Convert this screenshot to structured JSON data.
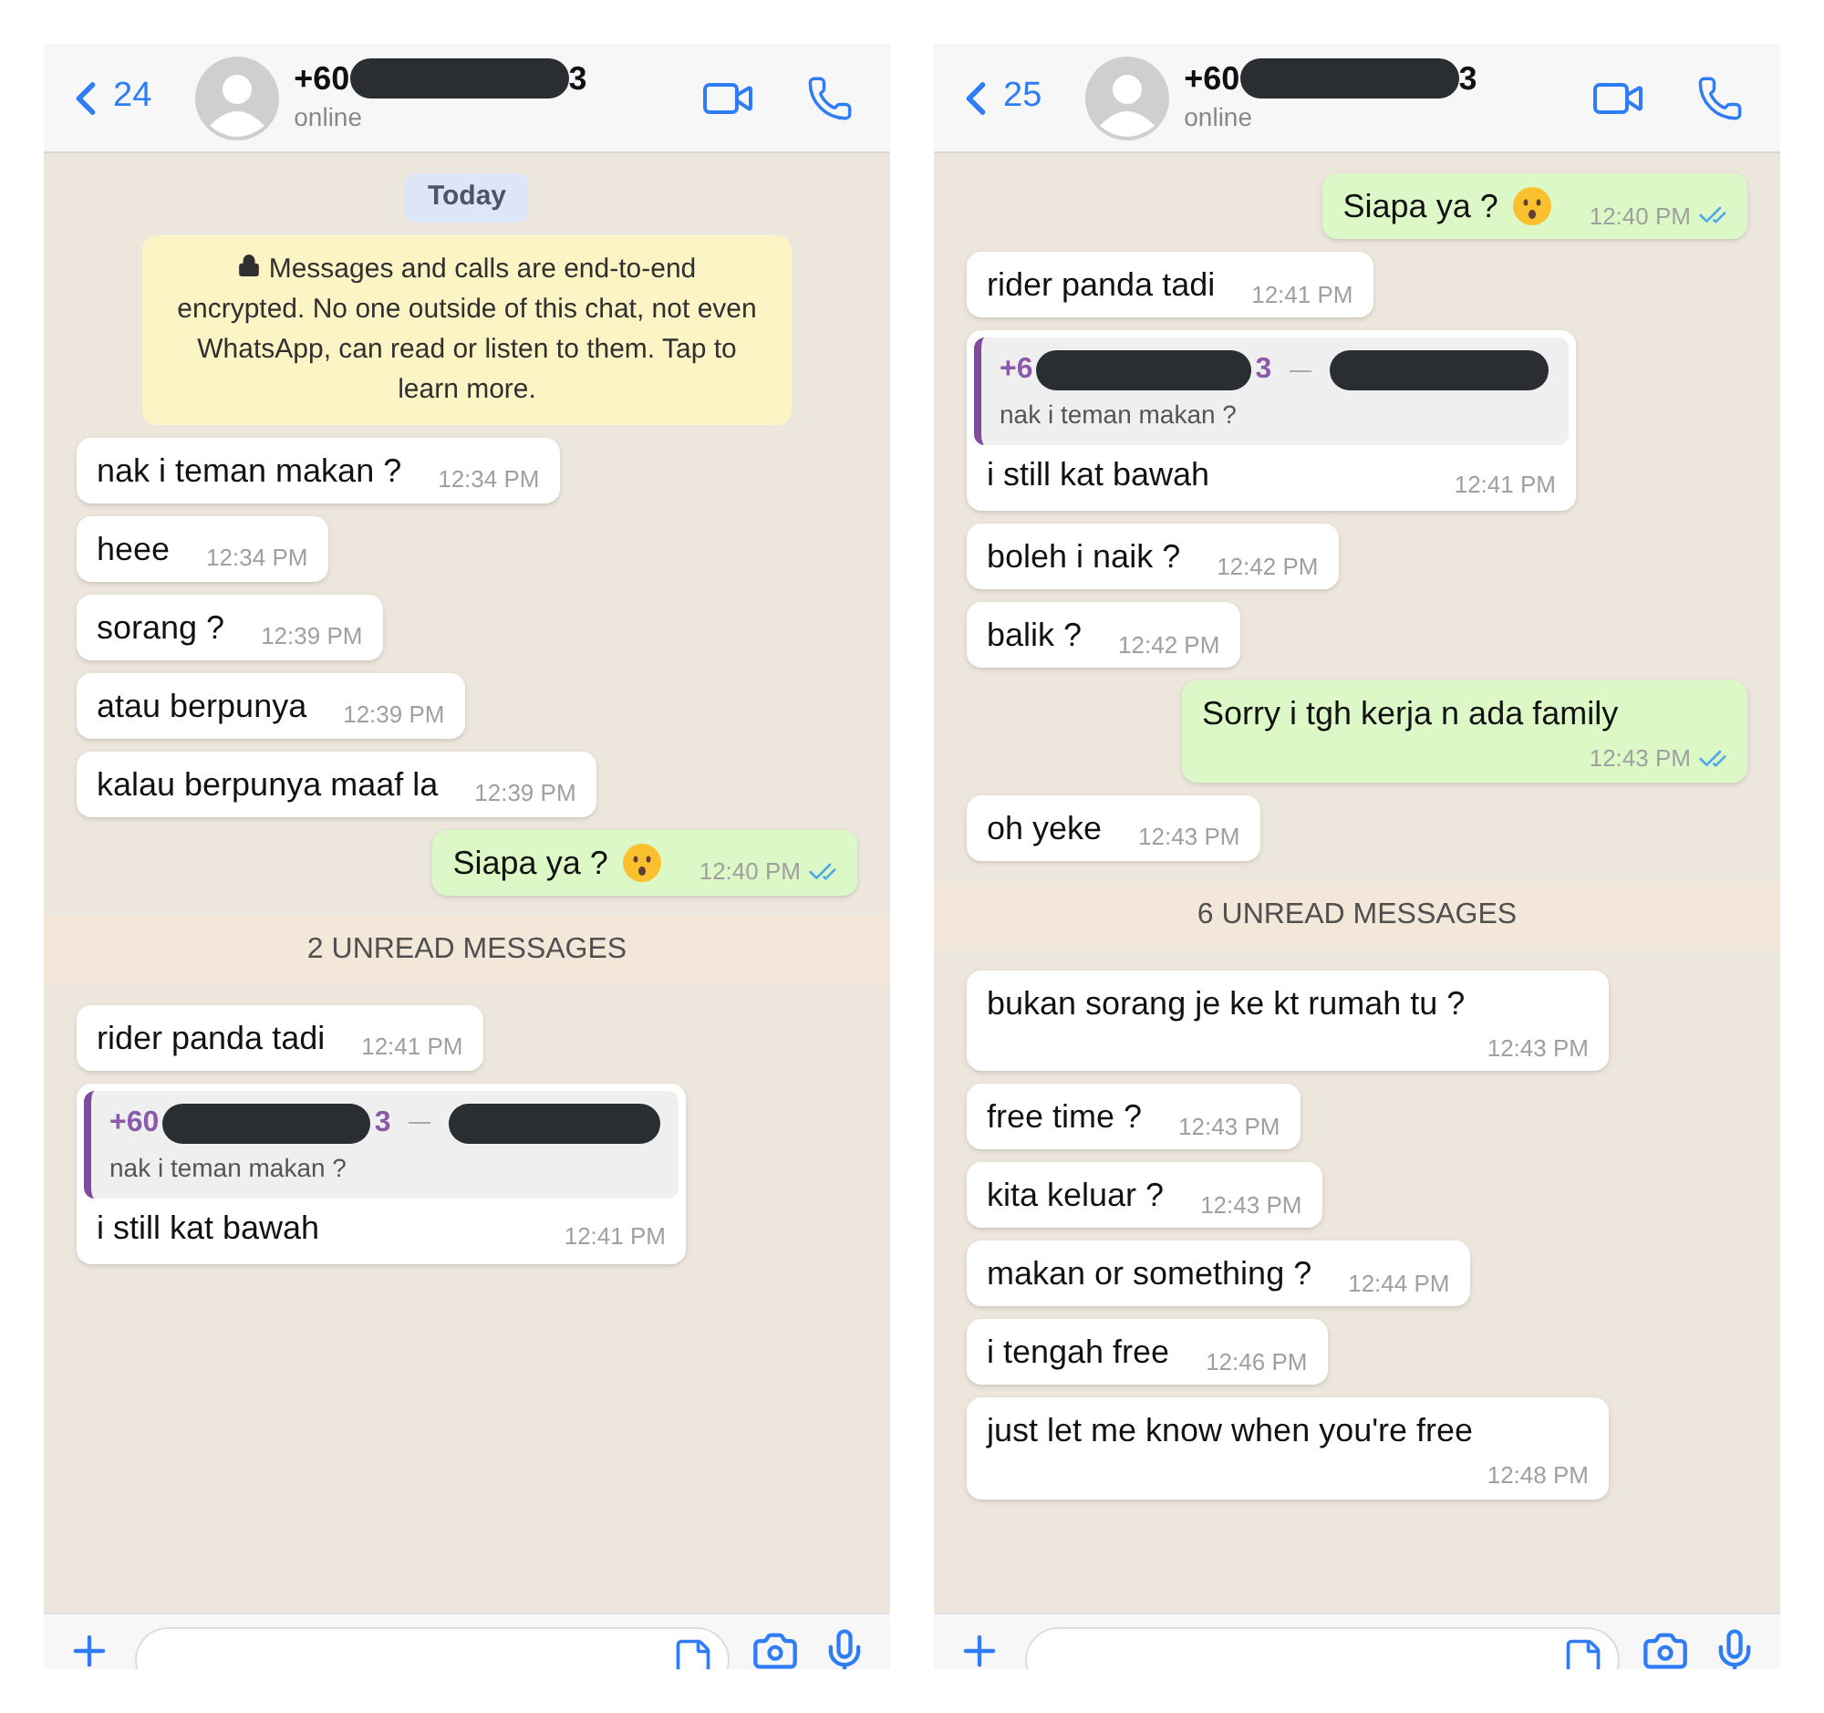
{
  "phones": [
    {
      "back_count": "24",
      "contact": {
        "name_start": "+60",
        "name_end": "3",
        "status": "online"
      },
      "messages": [
        {
          "kind": "date",
          "text": "Today"
        },
        {
          "kind": "notice",
          "text": "Messages and calls are end-to-end encrypted. No one outside of this chat, not even WhatsApp, can read or listen to them. Tap to learn more."
        },
        {
          "kind": "in",
          "text": "nak i teman makan ?",
          "time": "12:34 PM"
        },
        {
          "kind": "in",
          "text": "heee",
          "time": "12:34 PM"
        },
        {
          "kind": "in",
          "text": "sorang ?",
          "time": "12:39 PM"
        },
        {
          "kind": "in",
          "text": "atau berpunya",
          "time": "12:39 PM"
        },
        {
          "kind": "in",
          "text": "kalau berpunya maaf la",
          "time": "12:39 PM"
        },
        {
          "kind": "out",
          "text": "Siapa ya ?",
          "has_emoji": true,
          "time": "12:40 PM",
          "read": true
        },
        {
          "kind": "divider",
          "text": "2 UNREAD MESSAGES"
        },
        {
          "kind": "in",
          "text": "rider panda tadi",
          "time": "12:41 PM"
        },
        {
          "kind": "reply",
          "quote": {
            "sender_start": "+60",
            "sender_end": "3",
            "text": "nak i teman makan ?"
          },
          "text": "i still kat bawah",
          "time": "12:41 PM"
        }
      ]
    },
    {
      "back_count": "25",
      "contact": {
        "name_start": "+60",
        "name_end": "3",
        "status": "online"
      },
      "messages": [
        {
          "kind": "out",
          "text": "Siapa ya ?",
          "has_emoji": true,
          "time": "12:40 PM",
          "read": true
        },
        {
          "kind": "in",
          "text": "rider panda tadi",
          "time": "12:41 PM"
        },
        {
          "kind": "reply",
          "quote": {
            "sender_start": "+6",
            "sender_end": "3",
            "text": "nak i teman makan ?"
          },
          "text": "i still kat bawah",
          "time": "12:41 PM"
        },
        {
          "kind": "in",
          "text": "boleh i naik ?",
          "time": "12:42 PM"
        },
        {
          "kind": "in",
          "text": "balik ?",
          "time": "12:42 PM"
        },
        {
          "kind": "out",
          "text": "Sorry i tgh kerja n ada family",
          "time": "12:43 PM",
          "read": true
        },
        {
          "kind": "in",
          "text": "oh yeke",
          "time": "12:43 PM"
        },
        {
          "kind": "divider",
          "text": "6 UNREAD MESSAGES"
        },
        {
          "kind": "in",
          "text": "bukan sorang je ke kt rumah tu ?",
          "time": "12:43 PM"
        },
        {
          "kind": "in",
          "text": "free time ?",
          "time": "12:43 PM"
        },
        {
          "kind": "in",
          "text": "kita keluar ?",
          "time": "12:43 PM"
        },
        {
          "kind": "in",
          "text": "makan or something ?",
          "time": "12:44 PM"
        },
        {
          "kind": "in",
          "text": "i tengah free",
          "time": "12:46 PM"
        },
        {
          "kind": "in",
          "text": "just let me know when you're free",
          "time": "12:48 PM"
        }
      ]
    }
  ]
}
